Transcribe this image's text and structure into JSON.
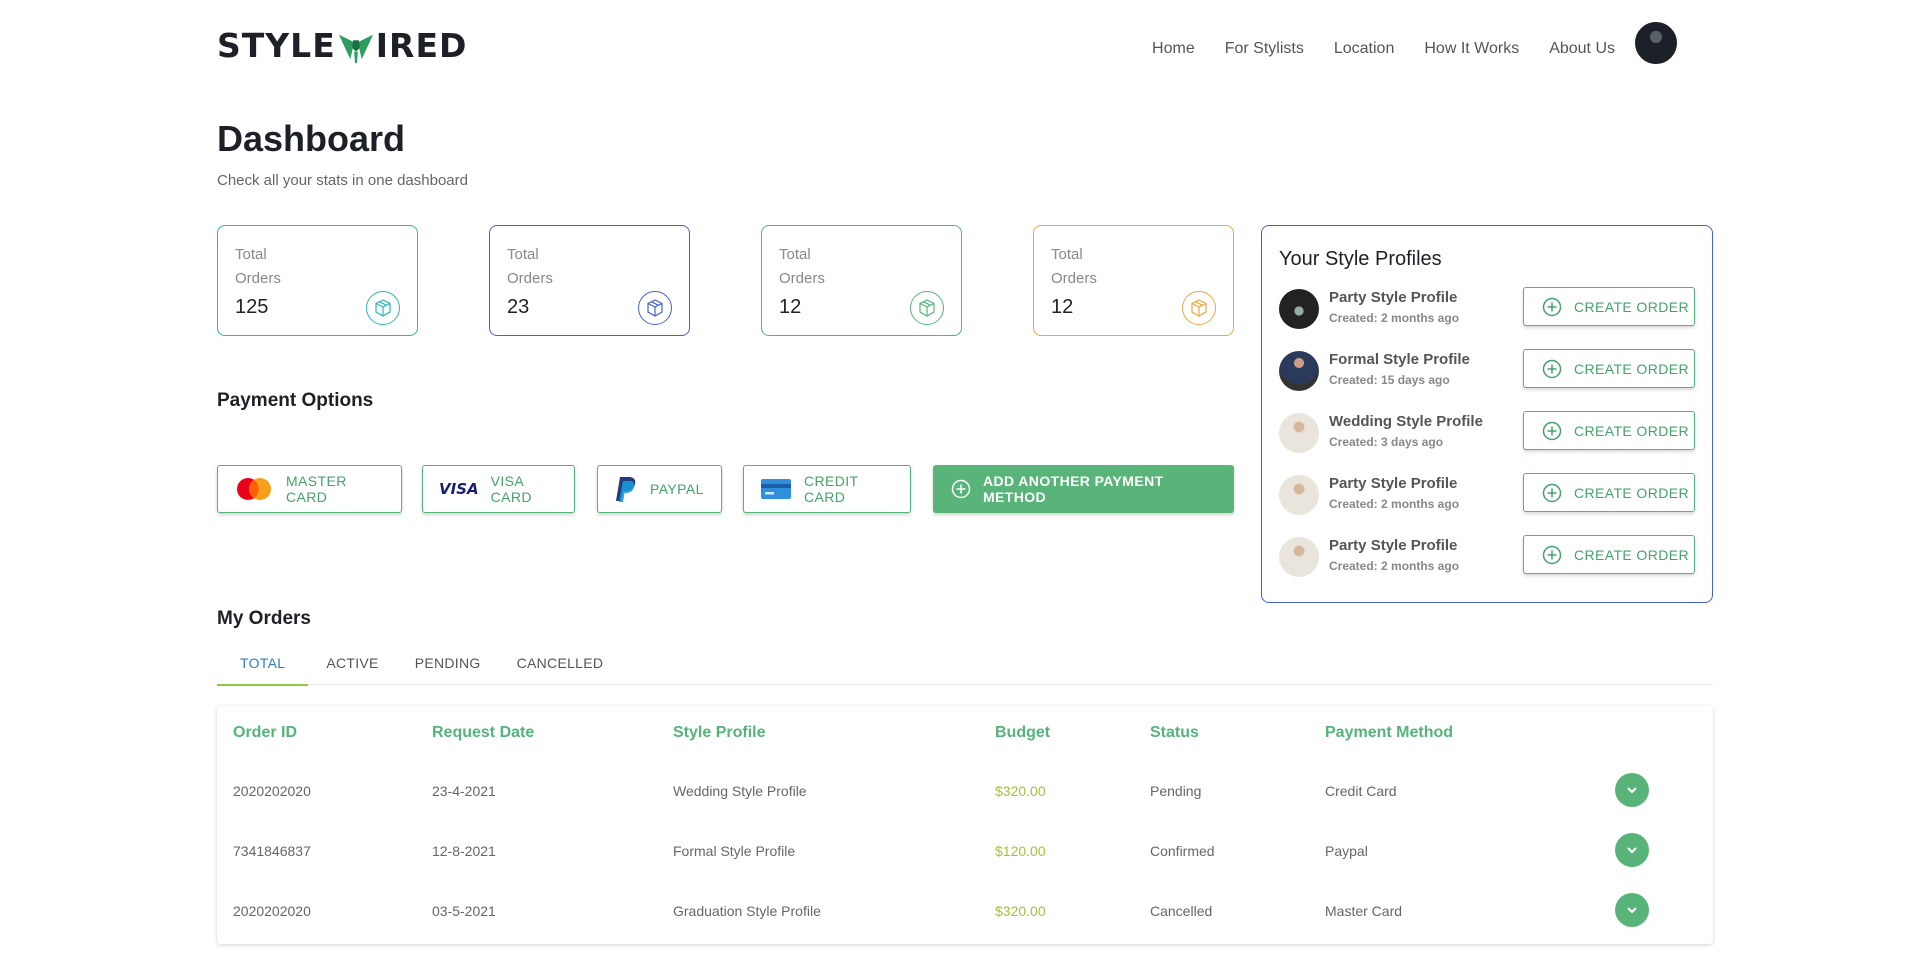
{
  "header": {
    "logo_left": "STYLE",
    "logo_right": "IRED",
    "nav": [
      "Home",
      "For Stylists",
      "Location",
      "How It Works",
      "About Us"
    ]
  },
  "page": {
    "title": "Dashboard",
    "subtitle": "Check all your stats in one dashboard"
  },
  "stats": [
    {
      "label": "Total Orders",
      "value": "125",
      "color": "#2bb5b8"
    },
    {
      "label": "Total Orders",
      "value": "23",
      "color": "#4760d4"
    },
    {
      "label": "Total Orders",
      "value": "12",
      "color": "#55b479"
    },
    {
      "label": "Total Orders",
      "value": "12",
      "color": "#f0a640"
    }
  ],
  "payment": {
    "title": "Payment Options",
    "methods": [
      {
        "label": "MASTER CARD",
        "icon": "mastercard-icon"
      },
      {
        "label": "VISA CARD",
        "icon": "visa-icon"
      },
      {
        "label": "PAYPAL",
        "icon": "paypal-icon"
      },
      {
        "label": "CREDIT CARD",
        "icon": "credit-card-icon"
      }
    ],
    "add_label": "ADD ANOTHER PAYMENT METHOD"
  },
  "profiles": {
    "title": "Your Style Profiles",
    "button_label": "CREATE ORDER",
    "items": [
      {
        "name": "Party Style Profile",
        "created": "Created: 2 months ago"
      },
      {
        "name": "Formal Style Profile",
        "created": "Created: 15 days ago"
      },
      {
        "name": "Wedding Style Profile",
        "created": "Created: 3 days ago"
      },
      {
        "name": "Party Style Profile",
        "created": "Created: 2 months ago"
      },
      {
        "name": "Party Style Profile",
        "created": "Created: 2 months ago"
      }
    ]
  },
  "orders": {
    "title": "My Orders",
    "tabs": [
      "TOTAL",
      "ACTIVE",
      "PENDING",
      "CANCELLED"
    ],
    "active_tab": "TOTAL",
    "columns": [
      "Order ID",
      "Request Date",
      "Style Profile",
      "Budget",
      "Status",
      "Payment Method"
    ],
    "rows": [
      [
        "2020202020",
        "23-4-2021",
        "Wedding Style Profile",
        "$320.00",
        "Pending",
        "Credit Card"
      ],
      [
        "7341846837",
        "12-8-2021",
        "Formal Style Profile",
        "$120.00",
        "Confirmed",
        "Paypal"
      ],
      [
        "2020202020",
        "03-5-2021",
        "Graduation Style Profile",
        "$320.00",
        "Cancelled",
        "Master Card"
      ]
    ]
  }
}
